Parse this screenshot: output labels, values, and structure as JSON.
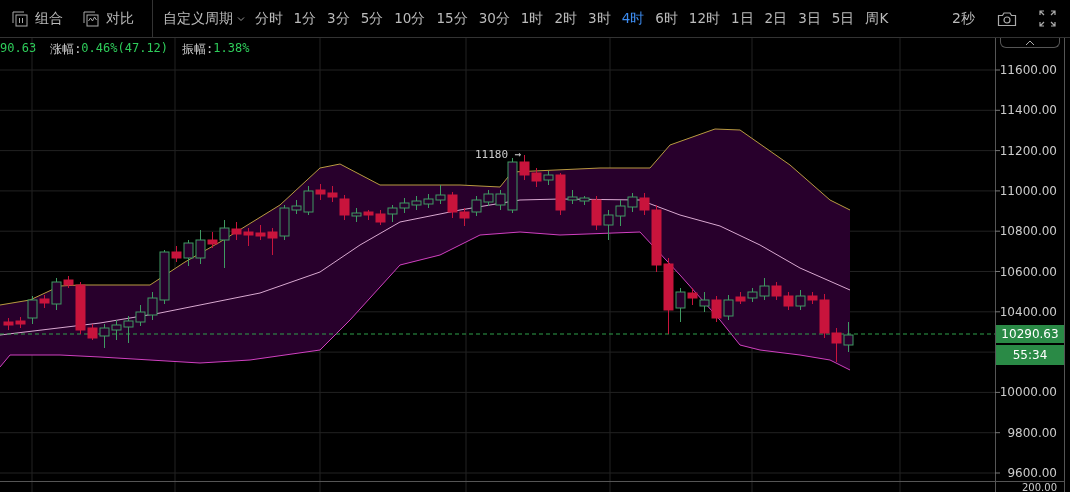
{
  "toolbar": {
    "left_buttons": [
      {
        "label": "组合",
        "kind": "combine"
      },
      {
        "label": "对比",
        "kind": "compare"
      }
    ],
    "custom_period": {
      "label": "自定义周期"
    },
    "periods": [
      {
        "label": "分时",
        "selected": false
      },
      {
        "label": "1分",
        "selected": false
      },
      {
        "label": "3分",
        "selected": false
      },
      {
        "label": "5分",
        "selected": false
      },
      {
        "label": "10分",
        "selected": false
      },
      {
        "label": "15分",
        "selected": false
      },
      {
        "label": "30分",
        "selected": false
      },
      {
        "label": "1时",
        "selected": false
      },
      {
        "label": "2时",
        "selected": false
      },
      {
        "label": "3时",
        "selected": false
      },
      {
        "label": "4时",
        "selected": true
      },
      {
        "label": "6时",
        "selected": false
      },
      {
        "label": "12时",
        "selected": false
      },
      {
        "label": "1日",
        "selected": false
      },
      {
        "label": "2日",
        "selected": false
      },
      {
        "label": "3日",
        "selected": false
      },
      {
        "label": "5日",
        "selected": false
      },
      {
        "label": "周K",
        "selected": false
      }
    ],
    "refresh_interval": "2秒"
  },
  "info": {
    "price_fragment": "90.63",
    "change_label": "涨幅:",
    "change_value": "0.46%(47.12)",
    "amplitude_label": "振幅:",
    "amplitude_value": "1.38%"
  },
  "chart": {
    "high_marker": "11180 →",
    "y_axis_labels": [
      "11600.00",
      "11400.00",
      "11200.00",
      "11000.00",
      "10800.00",
      "10600.00",
      "10400.00",
      "10000.00",
      "9800.00",
      "9600.00"
    ],
    "current_price": "10290.63",
    "countdown": "55:34",
    "lower_pane_label": "200.00"
  }
}
